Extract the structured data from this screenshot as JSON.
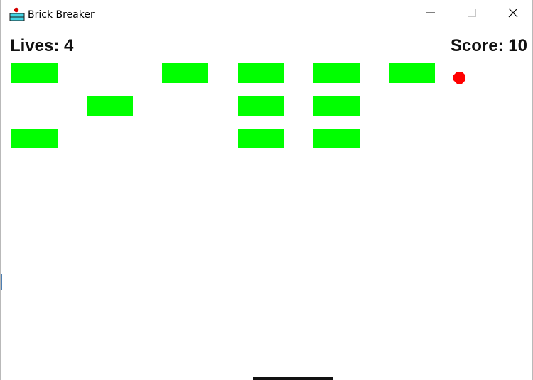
{
  "window": {
    "title": "Brick Breaker",
    "controls": {
      "minimize": "minimize-icon",
      "maximize": "maximize-icon",
      "close": "close-icon"
    }
  },
  "hud": {
    "lives_text": "Lives: 4",
    "score_text": "Score: 10"
  },
  "colors": {
    "brick": "#00ff00",
    "ball": "#ff0000",
    "paddle": "#111111"
  },
  "bricks": {
    "grid_columns": 7,
    "grid_rows": 3,
    "present": [
      {
        "row": 0,
        "col": 0
      },
      {
        "row": 0,
        "col": 2
      },
      {
        "row": 0,
        "col": 3
      },
      {
        "row": 0,
        "col": 4
      },
      {
        "row": 0,
        "col": 5
      },
      {
        "row": 1,
        "col": 1
      },
      {
        "row": 1,
        "col": 3
      },
      {
        "row": 1,
        "col": 4
      },
      {
        "row": 2,
        "col": 0
      },
      {
        "row": 2,
        "col": 3
      },
      {
        "row": 2,
        "col": 4
      }
    ]
  }
}
